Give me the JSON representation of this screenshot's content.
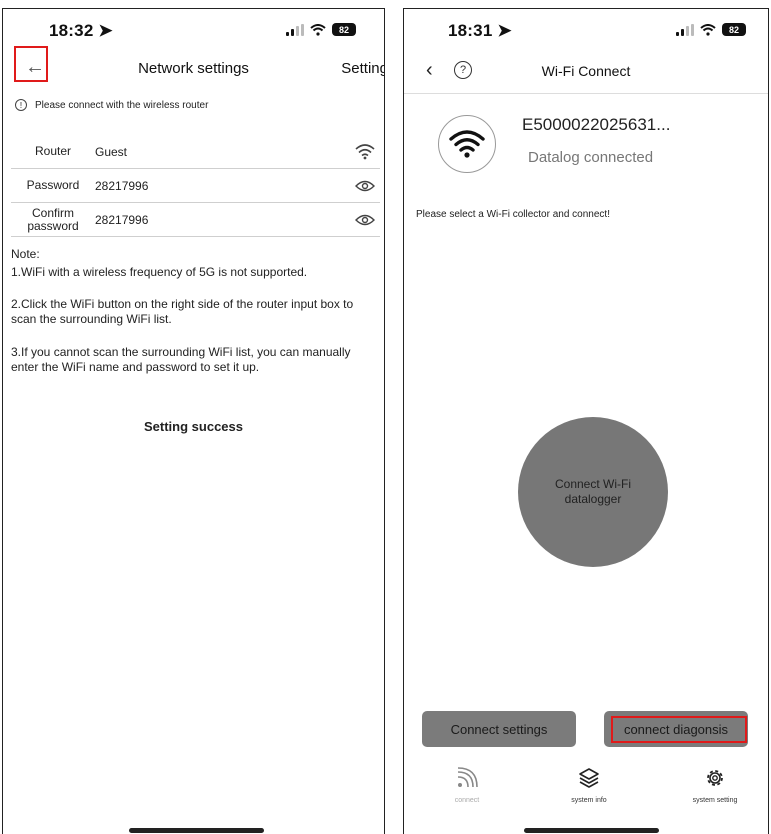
{
  "left_screen": {
    "status": {
      "time": "18:32",
      "battery": "82"
    },
    "title": "Network settings",
    "right_action": "Setting",
    "info": "Please connect with the wireless router",
    "form": [
      {
        "label": "Router",
        "value": "Guest",
        "icon": "wifi-icon"
      },
      {
        "label": "Password",
        "value": "28217996",
        "icon": "eye-icon"
      },
      {
        "label": "Confirm password",
        "value": "28217996",
        "icon": "eye-icon"
      }
    ],
    "note_title": "Note:",
    "notes": [
      "1.WiFi with a wireless frequency of 5G is not supported.",
      "2.Click the WiFi button on the right side of the router input box to scan the surrounding WiFi list.",
      "3.If you cannot scan the surrounding WiFi list, you can manually enter the WiFi name and password to set it up."
    ],
    "result": "Setting success",
    "highlight_color": "#e01a1a"
  },
  "right_screen": {
    "status": {
      "time": "18:31",
      "battery": "82"
    },
    "title": "Wi-Fi Connect",
    "device_id": "E5000022025631...",
    "device_status": "Datalog connected",
    "prompt": "Please select a Wi-Fi collector and connect!",
    "connect_button": "Connect Wi-Fi datalogger",
    "buttons": {
      "settings": "Connect settings",
      "diagnosis": "connect diagonsis"
    },
    "tabs": [
      {
        "label": "connect",
        "icon": "rss-icon"
      },
      {
        "label": "system info",
        "icon": "layers-icon"
      },
      {
        "label": "system setting",
        "icon": "gear-icon"
      }
    ],
    "highlight_color": "#e01a1a"
  }
}
